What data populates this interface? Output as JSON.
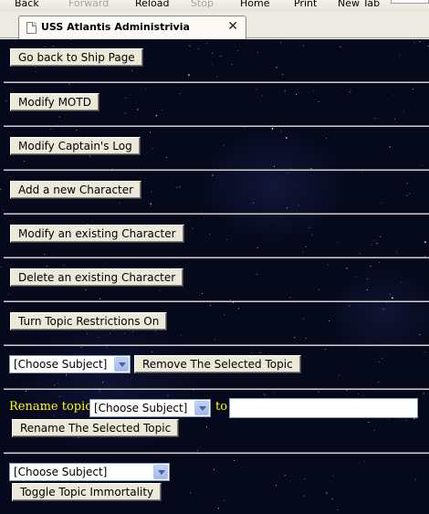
{
  "browser": {
    "toolbar": {
      "back": "Back",
      "forward": "Forward",
      "reload": "Reload",
      "stop": "Stop",
      "home": "Home",
      "print": "Print",
      "new_tab": "New Tab"
    },
    "tab": {
      "title": "USS Atlantis Administrivia",
      "close": "✕"
    }
  },
  "admin": {
    "go_back": "Go back to Ship Page",
    "modify_motd": "Modify MOTD",
    "modify_captains_log": "Modify Captain's Log",
    "add_character": "Add a new Character",
    "modify_character": "Modify an existing Character",
    "delete_character": "Delete an existing Character",
    "turn_restrictions_on": "Turn Topic Restrictions On",
    "remove_topic": {
      "select_value": "[Choose Subject]",
      "button": "Remove The Selected Topic"
    },
    "rename_topic": {
      "label": "Rename topic",
      "select_value": "[Choose Subject]",
      "to_label": "to",
      "new_name_value": "",
      "button": "Rename The Selected Topic"
    },
    "immortality": {
      "select_value": "[Choose Subject]",
      "button": "Toggle Topic Immortality"
    }
  },
  "colors": {
    "background": "#06081c",
    "label": "#ffff00",
    "button_face": "#ece9d8"
  }
}
